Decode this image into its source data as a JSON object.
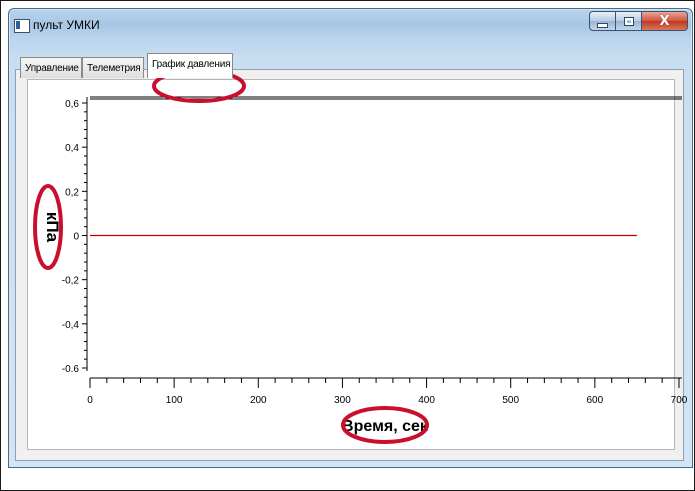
{
  "window": {
    "title": "пульт УМКИ",
    "close_glyph": "X"
  },
  "tabs": [
    {
      "label": "Управление",
      "active": false
    },
    {
      "label": "Телеметрия",
      "active": false
    },
    {
      "label": "График давления",
      "active": true
    }
  ],
  "icons": {
    "app": "app-window-icon",
    "minimize": "minimize-icon",
    "maximize": "maximize-icon",
    "close": "close-icon"
  },
  "colors": {
    "series_line": "#c00000",
    "annotation_ring": "#c8102e"
  },
  "chart_data": {
    "type": "line",
    "title": "",
    "xlabel": "Время, сек",
    "ylabel": "кПа",
    "xlim": [
      0,
      700
    ],
    "ylim": [
      -0.6,
      0.6
    ],
    "x_ticks": [
      "0",
      "100",
      "200",
      "300",
      "400",
      "500",
      "600",
      "700"
    ],
    "y_ticks": [
      "0,6",
      "0,4",
      "0,2",
      "0",
      "-0,2",
      "-0,4",
      "-0.6"
    ],
    "series": [
      {
        "x": [
          0,
          650
        ],
        "y": [
          0,
          0
        ]
      }
    ],
    "grid": false,
    "legend": "none"
  }
}
